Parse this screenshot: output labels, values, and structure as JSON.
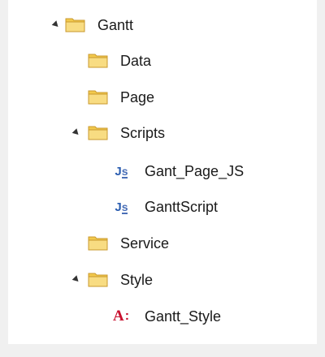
{
  "tree": {
    "root": {
      "label": "Gantt",
      "expanded": true,
      "icon": "folder-icon",
      "children": {
        "data": {
          "label": "Data",
          "icon": "folder-icon"
        },
        "page": {
          "label": "Page",
          "icon": "folder-icon"
        },
        "scripts": {
          "label": "Scripts",
          "expanded": true,
          "icon": "folder-icon",
          "children": {
            "gant_page_js": {
              "label": "Gant_Page_JS",
              "icon": "js-file-icon"
            },
            "ganttscript": {
              "label": "GanttScript",
              "icon": "js-file-icon"
            }
          }
        },
        "service": {
          "label": "Service",
          "icon": "folder-icon"
        },
        "style": {
          "label": "Style",
          "expanded": true,
          "icon": "folder-icon",
          "children": {
            "gantt_style": {
              "label": "Gantt_Style",
              "icon": "css-file-icon"
            }
          }
        }
      }
    }
  },
  "colors": {
    "folder_body": "#f5d36b",
    "folder_edge": "#c9992e",
    "js_badge": "#2a5db0",
    "css_badge": "#c8102e",
    "background": "#f0f0f0",
    "panel": "#ffffff"
  }
}
